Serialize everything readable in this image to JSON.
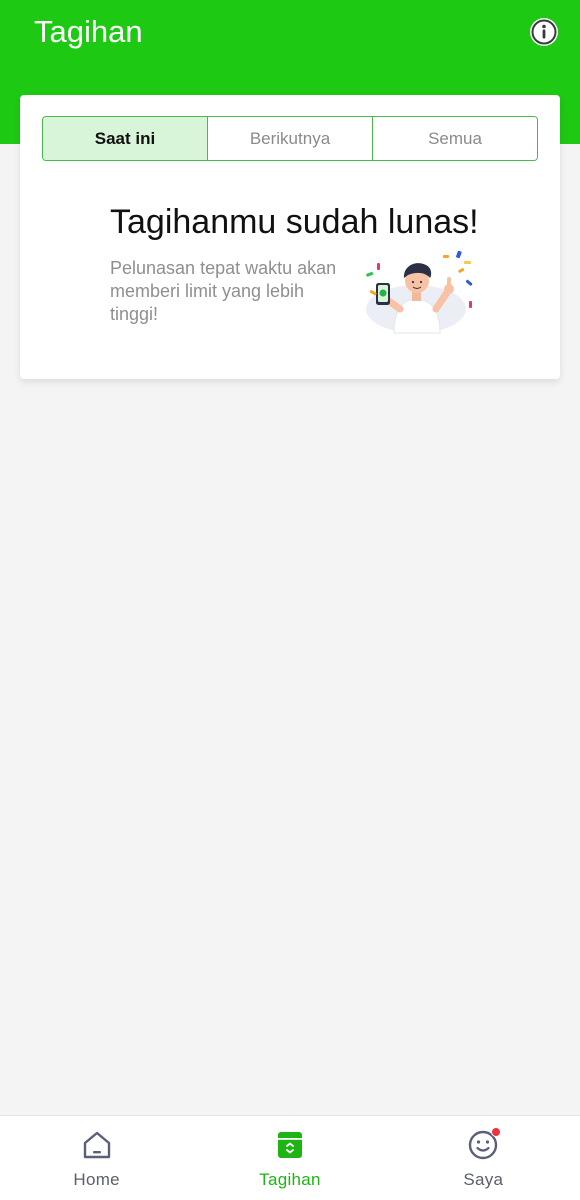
{
  "header": {
    "title": "Tagihan",
    "info_icon": "info-icon",
    "color": "#1ec914"
  },
  "tabs": [
    {
      "label": "Saat ini",
      "active": true
    },
    {
      "label": "Berikutnya",
      "active": false
    },
    {
      "label": "Semua",
      "active": false
    }
  ],
  "status": {
    "title": "Tagihanmu sudah lunas!",
    "description": "Pelunasan tepat waktu akan memberi limit yang lebih tinggi!",
    "illustration": "celebrating-man-illustration"
  },
  "bottom_nav": [
    {
      "label": "Home",
      "icon": "home-icon",
      "active": false
    },
    {
      "label": "Tagihan",
      "icon": "bill-icon",
      "active": true
    },
    {
      "label": "Saya",
      "icon": "smiley-icon",
      "active": false,
      "badge": true
    }
  ]
}
